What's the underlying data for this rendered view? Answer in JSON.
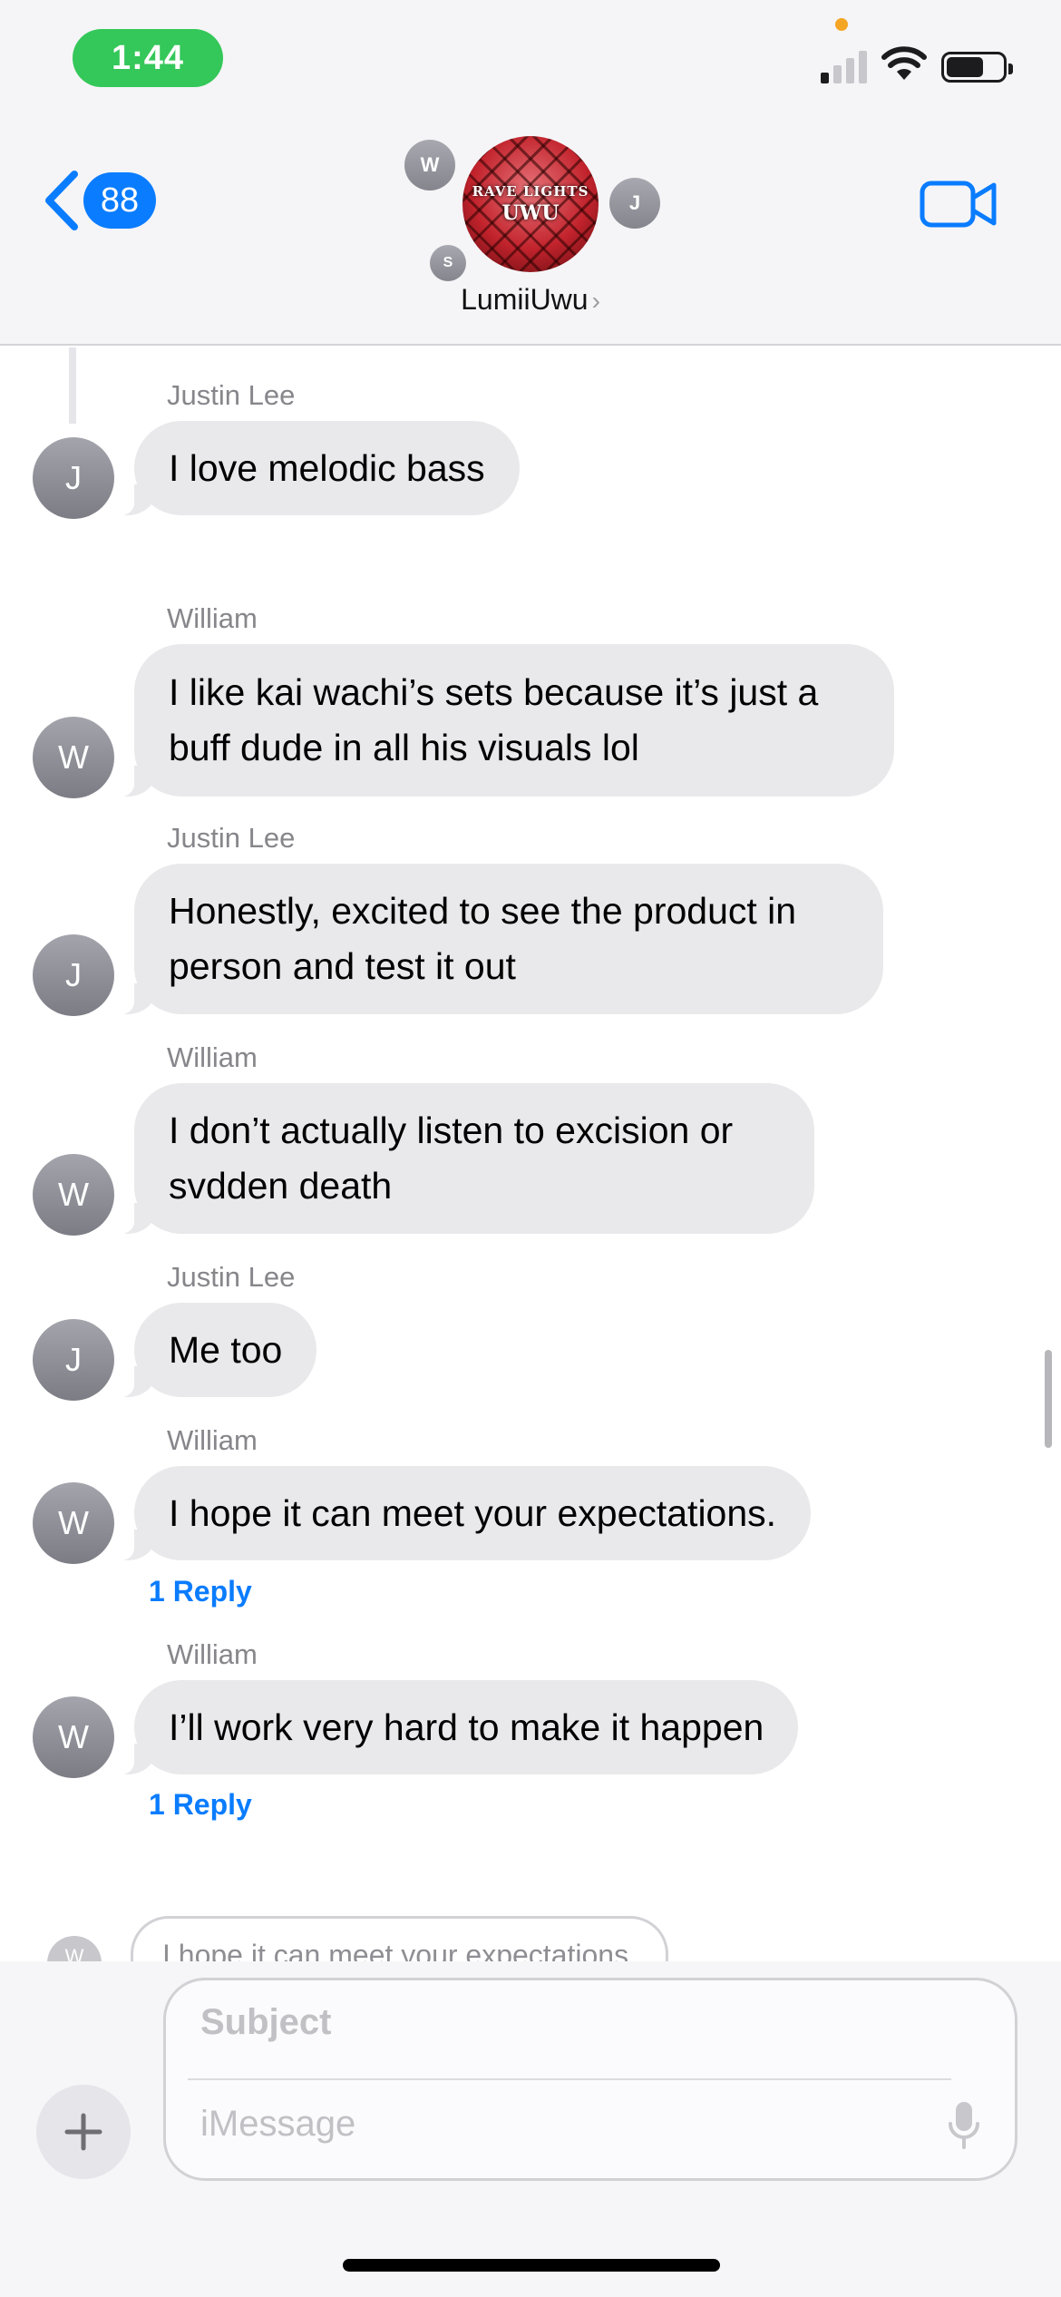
{
  "status_bar": {
    "time": "1:44",
    "signal_bars_active": 1,
    "battery_level": 0.66
  },
  "header": {
    "back_count": "88",
    "group_name": "LumiiUwu",
    "group_photo_text": [
      "RAVE LIGHTS",
      "UWU"
    ],
    "members": [
      "W",
      "J",
      "S"
    ]
  },
  "messages": [
    {
      "sender": "Justin Lee",
      "initial": "J",
      "lines": [
        "I love melodic bass"
      ]
    },
    {
      "sender": "William",
      "initial": "W",
      "lines": [
        "I like kai wachi’s sets because it’s just a",
        "buff dude in all his visuals lol"
      ]
    },
    {
      "sender": "Justin Lee",
      "initial": "J",
      "lines": [
        "Honestly, excited to see the product in",
        "person and test it out"
      ]
    },
    {
      "sender": "William",
      "initial": "W",
      "lines": [
        "I don’t actually listen to excision or",
        "svdden death"
      ]
    },
    {
      "sender": "Justin Lee",
      "initial": "J",
      "lines": [
        "Me too"
      ]
    },
    {
      "sender": "William",
      "initial": "W",
      "lines": [
        "I hope it can meet your expectations."
      ],
      "reply": "1 Reply"
    },
    {
      "sender": "William",
      "initial": "W",
      "lines": [
        "I’ll work very hard to make it happen"
      ],
      "reply": "1 Reply"
    }
  ],
  "preview": {
    "initial": "W",
    "text": "I hope it can meet your expectations."
  },
  "compose": {
    "subject_placeholder": "Subject",
    "message_placeholder": "iMessage"
  },
  "colors": {
    "accent": "#0a7cff",
    "time_pill": "#34c759",
    "bubble": "#e9e9eb"
  }
}
